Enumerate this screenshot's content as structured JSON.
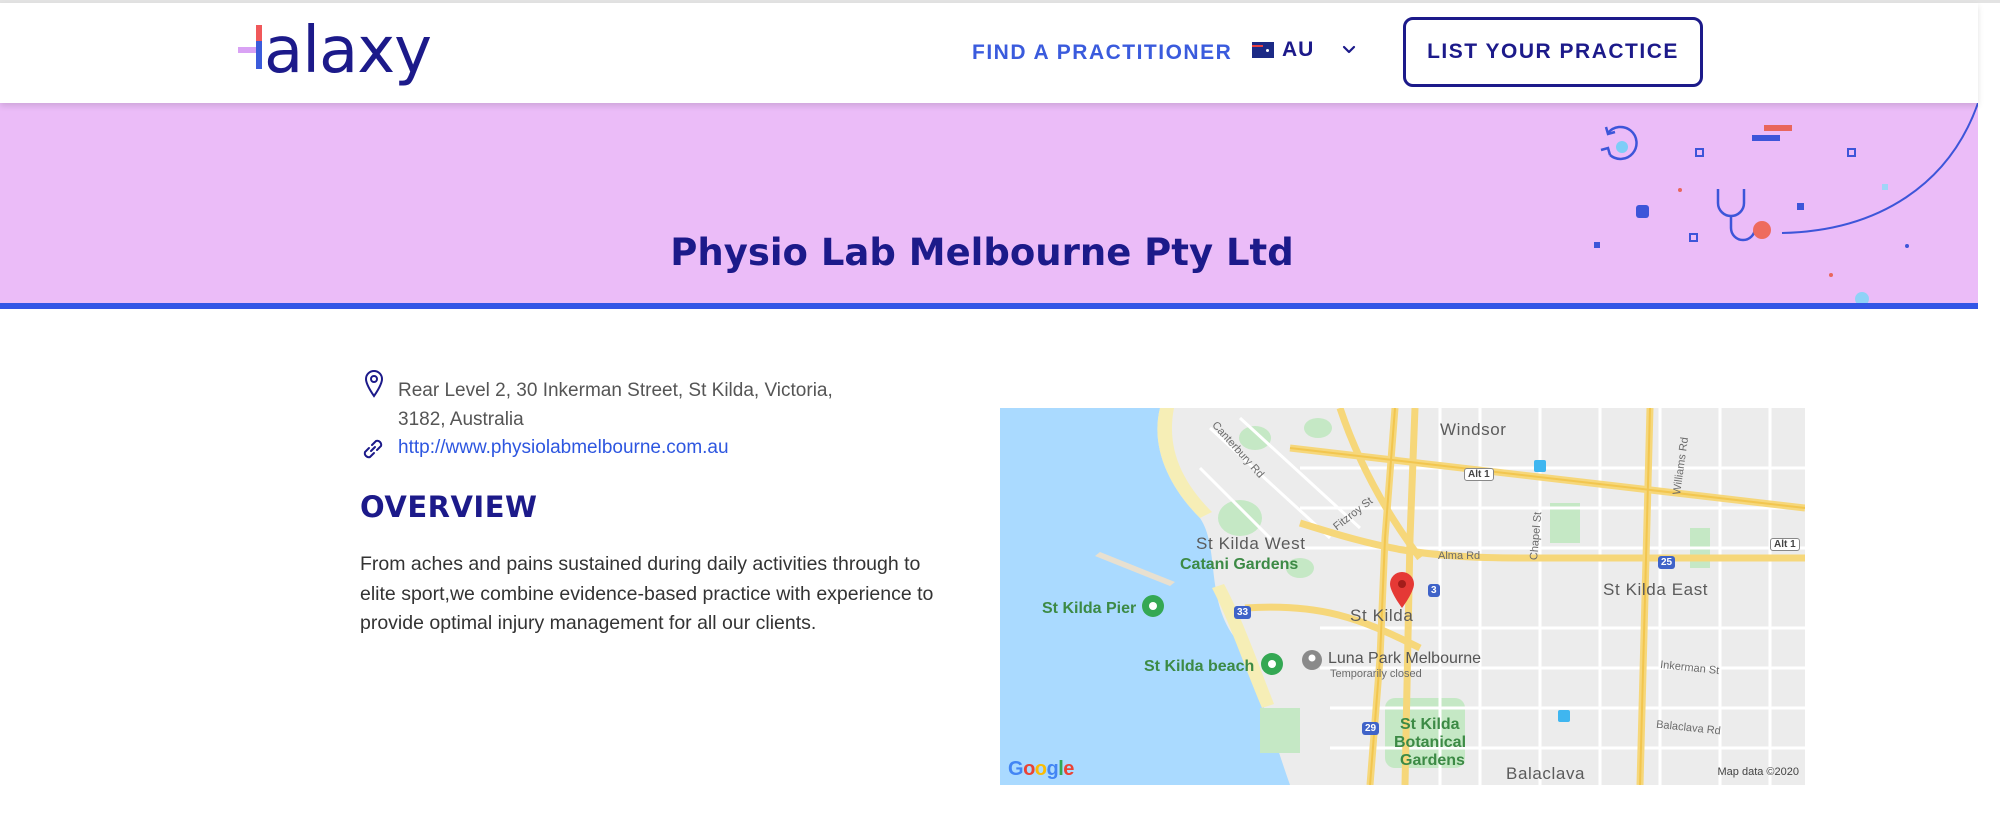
{
  "brand": {
    "logo_text": "Halaxy"
  },
  "header": {
    "find_label": "FIND A PRACTITIONER",
    "locale_code": "AU",
    "list_label": "LIST YOUR PRACTICE"
  },
  "banner": {
    "title": "Physio Lab Melbourne Pty Ltd"
  },
  "practice": {
    "address_line1": "Rear Level 2, 30 Inkerman Street, St Kilda, Victoria,",
    "address_line2": "3182, Australia",
    "website": "http://www.physiolabmelbourne.com.au",
    "overview_heading": "OVERVIEW",
    "overview_text": "From aches and pains sustained during daily activities through to elite sport,we combine evidence-based practice with experience to provide optimal injury management for all our clients."
  },
  "map": {
    "labels": {
      "windsor": "Windsor",
      "st_kilda_west": "St Kilda West",
      "catani": "Catani Gardens",
      "pier": "St Kilda Pier",
      "beach": "St Kilda beach",
      "st_kilda": "St Kilda",
      "st_kilda_east": "St Kilda East",
      "luna": "Luna Park Melbourne",
      "luna_note": "Temporarily closed",
      "botanical1": "St Kilda",
      "botanical2": "Botanical",
      "botanical3": "Gardens",
      "balaclava": "Balaclava",
      "canterbury": "Canterbury Rd",
      "fitzroy": "Fitzroy St",
      "alma": "Alma Rd",
      "chapel": "Chapel St",
      "williams": "Williams Rd",
      "inkerman": "Inkerman St",
      "balaclava_rd": "Balaclava Rd",
      "alt1a": "Alt 1",
      "alt1b": "Alt 1",
      "r25": "25",
      "r3": "3",
      "r33": "33",
      "r29": "29"
    },
    "google_letters": [
      "G",
      "o",
      "o",
      "g",
      "l",
      "e"
    ],
    "attribution": "Map data ©2020"
  },
  "colors": {
    "brand_navy": "#1c1a8a",
    "accent_blue": "#3356e6",
    "banner_bg": "#ebbcf8",
    "link_blue": "#2d56e0"
  }
}
